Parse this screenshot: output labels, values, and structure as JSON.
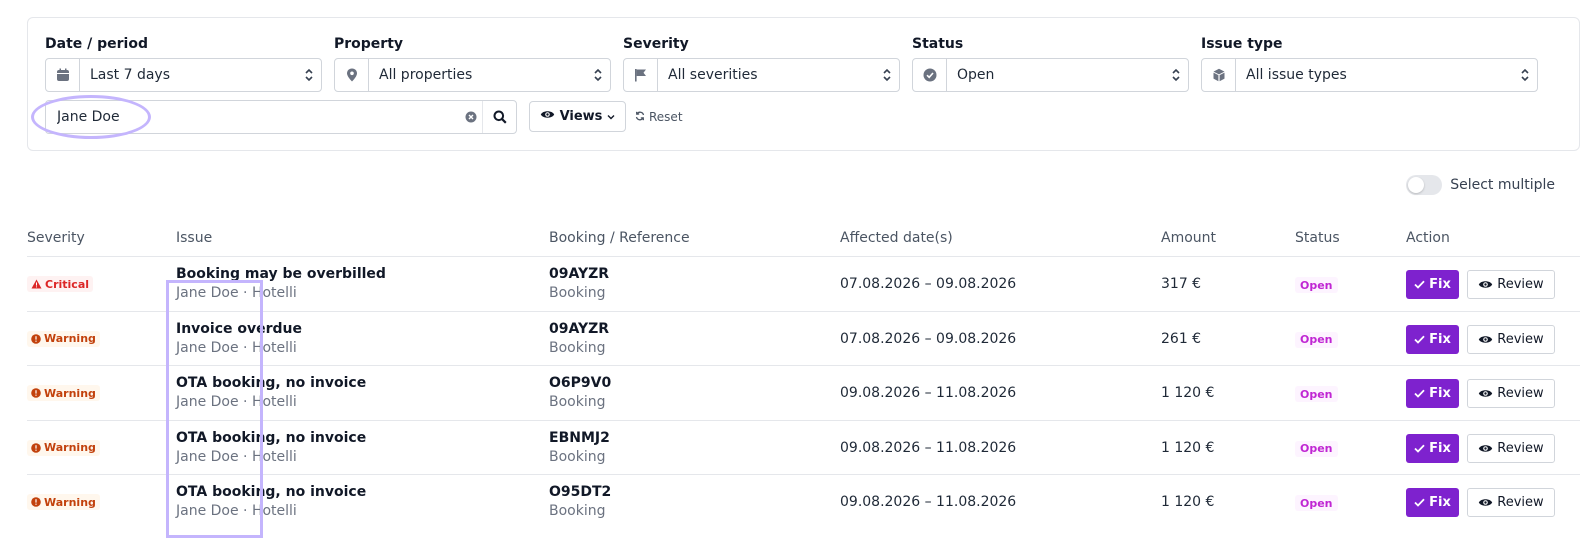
{
  "filters": {
    "date": {
      "label": "Date / period",
      "value": "Last 7 days",
      "icon": "calendar-icon"
    },
    "property": {
      "label": "Property",
      "value": "All properties",
      "icon": "map-pin-icon"
    },
    "severity": {
      "label": "Severity",
      "value": "All severities",
      "icon": "flag-icon"
    },
    "status": {
      "label": "Status",
      "value": "Open",
      "icon": "check-circle-icon"
    },
    "issue_type": {
      "label": "Issue type",
      "value": "All issue types",
      "icon": "cube-icon"
    },
    "search": {
      "value": "Jane Doe"
    },
    "views_label": "Views",
    "reset_label": "Reset"
  },
  "select_multiple_label": "Select multiple",
  "table": {
    "headers": {
      "severity": "Severity",
      "issue": "Issue",
      "booking": "Booking / Reference",
      "dates": "Affected date(s)",
      "amount": "Amount",
      "status": "Status",
      "action": "Action"
    },
    "rows": [
      {
        "severity": "Critical",
        "title": "Booking may be overbilled",
        "sub": "Jane Doe · Hotelli",
        "ref": "09AYZR",
        "ref_type": "Booking",
        "dates": "07.08.2026 – 09.08.2026",
        "amount": "317 €",
        "status": "Open",
        "fix": "Fix",
        "review": "Review"
      },
      {
        "severity": "Warning",
        "title": "Invoice overdue",
        "sub": "Jane Doe · Hotelli",
        "ref": "09AYZR",
        "ref_type": "Booking",
        "dates": "07.08.2026 – 09.08.2026",
        "amount": "261 €",
        "status": "Open",
        "fix": "Fix",
        "review": "Review"
      },
      {
        "severity": "Warning",
        "title": "OTA booking, no invoice",
        "sub": "Jane Doe · Hotelli",
        "ref": "O6P9V0",
        "ref_type": "Booking",
        "dates": "09.08.2026 – 11.08.2026",
        "amount": "1 120 €",
        "status": "Open",
        "fix": "Fix",
        "review": "Review"
      },
      {
        "severity": "Warning",
        "title": "OTA booking, no invoice",
        "sub": "Jane Doe · Hotelli",
        "ref": "EBNMJ2",
        "ref_type": "Booking",
        "dates": "09.08.2026 – 11.08.2026",
        "amount": "1 120 €",
        "status": "Open",
        "fix": "Fix",
        "review": "Review"
      },
      {
        "severity": "Warning",
        "title": "OTA booking, no invoice",
        "sub": "Jane Doe · Hotelli",
        "ref": "O95DT2",
        "ref_type": "Booking",
        "dates": "09.08.2026 – 11.08.2026",
        "amount": "1 120 €",
        "status": "Open",
        "fix": "Fix",
        "review": "Review"
      }
    ]
  },
  "colors": {
    "accent": "#7e22ce",
    "critical": "#dc2626",
    "warning": "#c2410c",
    "status_open": "#c026d3",
    "highlight": "#c4b5fd"
  }
}
